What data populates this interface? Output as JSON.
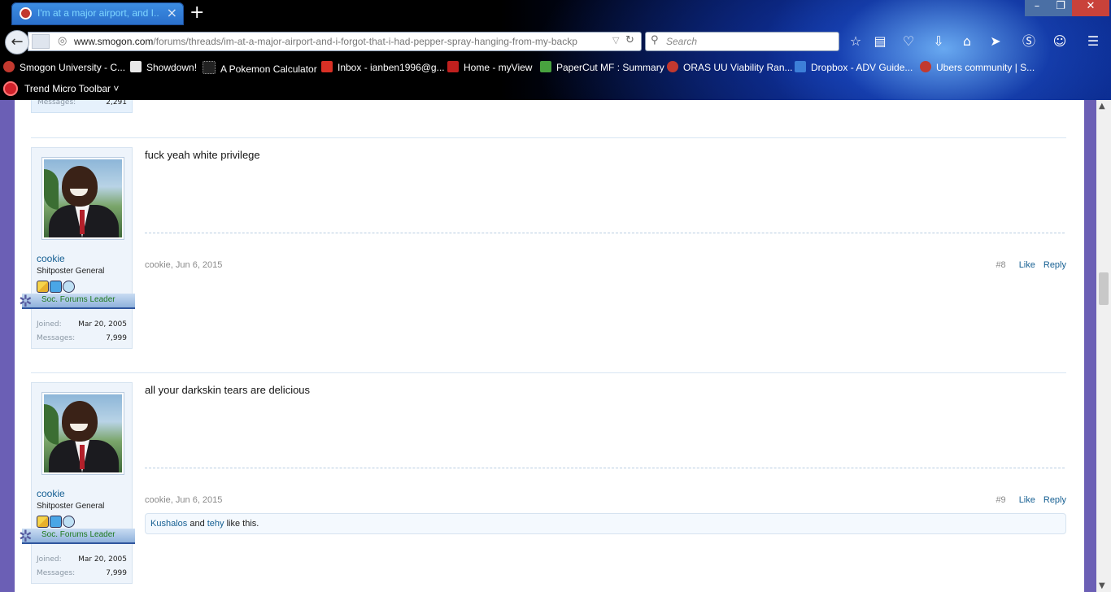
{
  "browser": {
    "tab_title": "I'm at a major airport, and I...",
    "url_domain": "www.smogon.com",
    "url_path": "/forums/threads/im-at-a-major-airport-and-i-forgot-that-i-had-pepper-spray-hanging-from-my-backp",
    "search_placeholder": "Search",
    "bookmarks": [
      {
        "label": "Smogon University - C...",
        "icon_color": "#c2392f"
      },
      {
        "label": "Showdown!",
        "icon_color": "#e8e8e8"
      },
      {
        "label": "A Pokemon Calculator",
        "icon_color": "#222222"
      },
      {
        "label": "Inbox - ianben1996@g...",
        "icon_color": "#d93025"
      },
      {
        "label": "Home - myView",
        "icon_color": "#c0201e"
      },
      {
        "label": "PaperCut MF : Summary",
        "icon_color": "#48a23f"
      },
      {
        "label": "ORAS UU Viability Ran...",
        "icon_color": "#c2392f"
      },
      {
        "label": "Dropbox - ADV Guide...",
        "icon_color": "#3d7fd8"
      },
      {
        "label": "Ubers community | S...",
        "icon_color": "#c2392f"
      }
    ],
    "trend_label": "Trend Micro Toolbar"
  },
  "top_fragment": {
    "messages_label": "Messages:",
    "messages_value": "2,291"
  },
  "posts": [
    {
      "username": "cookie",
      "user_title": "Shitposter General",
      "ribbon": "Soc. Forums Leader",
      "joined_label": "Joined:",
      "joined": "Mar 20, 2005",
      "messages_label": "Messages:",
      "messages": "7,999",
      "message": "fuck yeah white privilege",
      "meta": "cookie, Jun 6, 2015",
      "number": "#8",
      "like": "Like",
      "reply": "Reply"
    },
    {
      "username": "cookie",
      "user_title": "Shitposter General",
      "ribbon": "Soc. Forums Leader",
      "joined_label": "Joined:",
      "joined": "Mar 20, 2005",
      "messages_label": "Messages:",
      "messages": "7,999",
      "message": "all your darkskin tears are delicious",
      "meta": "cookie, Jun 6, 2015",
      "number": "#9",
      "like": "Like",
      "reply": "Reply",
      "likes": {
        "user1": "Kushalos",
        "and": "and",
        "user2": "tehy",
        "suffix": "like this."
      }
    }
  ]
}
